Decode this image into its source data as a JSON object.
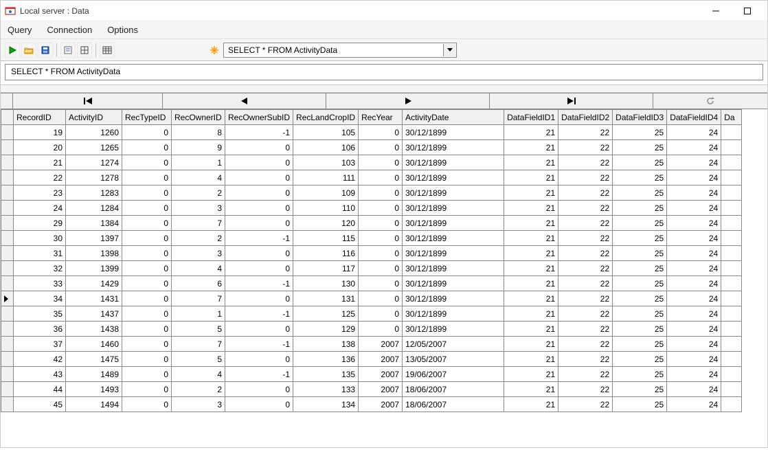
{
  "window": {
    "title": "Local server : Data"
  },
  "menu": {
    "query": "Query",
    "connection": "Connection",
    "options": "Options"
  },
  "toolbar": {
    "query_dropdown": "SELECT * FROM ActivityData"
  },
  "query_text": "SELECT * FROM ActivityData",
  "grid": {
    "current_row_index": 11,
    "columns": [
      "RecordID",
      "ActivityID",
      "RecTypeID",
      "RecOwnerID",
      "RecOwnerSubID",
      "RecLandCropID",
      "RecYear",
      "ActivityDate",
      "DataFieldID1",
      "DataFieldID2",
      "DataFieldID3",
      "DataFieldID4",
      "Da"
    ],
    "rows": [
      {
        "RecordID": 19,
        "ActivityID": 1260,
        "RecTypeID": 0,
        "RecOwnerID": 8,
        "RecOwnerSubID": -1,
        "RecLandCropID": 105,
        "RecYear": 0,
        "ActivityDate": "30/12/1899",
        "DataFieldID1": 21,
        "DataFieldID2": 22,
        "DataFieldID3": 25,
        "DataFieldID4": 24
      },
      {
        "RecordID": 20,
        "ActivityID": 1265,
        "RecTypeID": 0,
        "RecOwnerID": 9,
        "RecOwnerSubID": 0,
        "RecLandCropID": 106,
        "RecYear": 0,
        "ActivityDate": "30/12/1899",
        "DataFieldID1": 21,
        "DataFieldID2": 22,
        "DataFieldID3": 25,
        "DataFieldID4": 24
      },
      {
        "RecordID": 21,
        "ActivityID": 1274,
        "RecTypeID": 0,
        "RecOwnerID": 1,
        "RecOwnerSubID": 0,
        "RecLandCropID": 103,
        "RecYear": 0,
        "ActivityDate": "30/12/1899",
        "DataFieldID1": 21,
        "DataFieldID2": 22,
        "DataFieldID3": 25,
        "DataFieldID4": 24
      },
      {
        "RecordID": 22,
        "ActivityID": 1278,
        "RecTypeID": 0,
        "RecOwnerID": 4,
        "RecOwnerSubID": 0,
        "RecLandCropID": 111,
        "RecYear": 0,
        "ActivityDate": "30/12/1899",
        "DataFieldID1": 21,
        "DataFieldID2": 22,
        "DataFieldID3": 25,
        "DataFieldID4": 24
      },
      {
        "RecordID": 23,
        "ActivityID": 1283,
        "RecTypeID": 0,
        "RecOwnerID": 2,
        "RecOwnerSubID": 0,
        "RecLandCropID": 109,
        "RecYear": 0,
        "ActivityDate": "30/12/1899",
        "DataFieldID1": 21,
        "DataFieldID2": 22,
        "DataFieldID3": 25,
        "DataFieldID4": 24
      },
      {
        "RecordID": 24,
        "ActivityID": 1284,
        "RecTypeID": 0,
        "RecOwnerID": 3,
        "RecOwnerSubID": 0,
        "RecLandCropID": 110,
        "RecYear": 0,
        "ActivityDate": "30/12/1899",
        "DataFieldID1": 21,
        "DataFieldID2": 22,
        "DataFieldID3": 25,
        "DataFieldID4": 24
      },
      {
        "RecordID": 29,
        "ActivityID": 1384,
        "RecTypeID": 0,
        "RecOwnerID": 7,
        "RecOwnerSubID": 0,
        "RecLandCropID": 120,
        "RecYear": 0,
        "ActivityDate": "30/12/1899",
        "DataFieldID1": 21,
        "DataFieldID2": 22,
        "DataFieldID3": 25,
        "DataFieldID4": 24
      },
      {
        "RecordID": 30,
        "ActivityID": 1397,
        "RecTypeID": 0,
        "RecOwnerID": 2,
        "RecOwnerSubID": -1,
        "RecLandCropID": 115,
        "RecYear": 0,
        "ActivityDate": "30/12/1899",
        "DataFieldID1": 21,
        "DataFieldID2": 22,
        "DataFieldID3": 25,
        "DataFieldID4": 24
      },
      {
        "RecordID": 31,
        "ActivityID": 1398,
        "RecTypeID": 0,
        "RecOwnerID": 3,
        "RecOwnerSubID": 0,
        "RecLandCropID": 116,
        "RecYear": 0,
        "ActivityDate": "30/12/1899",
        "DataFieldID1": 21,
        "DataFieldID2": 22,
        "DataFieldID3": 25,
        "DataFieldID4": 24
      },
      {
        "RecordID": 32,
        "ActivityID": 1399,
        "RecTypeID": 0,
        "RecOwnerID": 4,
        "RecOwnerSubID": 0,
        "RecLandCropID": 117,
        "RecYear": 0,
        "ActivityDate": "30/12/1899",
        "DataFieldID1": 21,
        "DataFieldID2": 22,
        "DataFieldID3": 25,
        "DataFieldID4": 24
      },
      {
        "RecordID": 33,
        "ActivityID": 1429,
        "RecTypeID": 0,
        "RecOwnerID": 6,
        "RecOwnerSubID": -1,
        "RecLandCropID": 130,
        "RecYear": 0,
        "ActivityDate": "30/12/1899",
        "DataFieldID1": 21,
        "DataFieldID2": 22,
        "DataFieldID3": 25,
        "DataFieldID4": 24
      },
      {
        "RecordID": 34,
        "ActivityID": 1431,
        "RecTypeID": 0,
        "RecOwnerID": 7,
        "RecOwnerSubID": 0,
        "RecLandCropID": 131,
        "RecYear": 0,
        "ActivityDate": "30/12/1899",
        "DataFieldID1": 21,
        "DataFieldID2": 22,
        "DataFieldID3": 25,
        "DataFieldID4": 24
      },
      {
        "RecordID": 35,
        "ActivityID": 1437,
        "RecTypeID": 0,
        "RecOwnerID": 1,
        "RecOwnerSubID": -1,
        "RecLandCropID": 125,
        "RecYear": 0,
        "ActivityDate": "30/12/1899",
        "DataFieldID1": 21,
        "DataFieldID2": 22,
        "DataFieldID3": 25,
        "DataFieldID4": 24
      },
      {
        "RecordID": 36,
        "ActivityID": 1438,
        "RecTypeID": 0,
        "RecOwnerID": 5,
        "RecOwnerSubID": 0,
        "RecLandCropID": 129,
        "RecYear": 0,
        "ActivityDate": "30/12/1899",
        "DataFieldID1": 21,
        "DataFieldID2": 22,
        "DataFieldID3": 25,
        "DataFieldID4": 24
      },
      {
        "RecordID": 37,
        "ActivityID": 1460,
        "RecTypeID": 0,
        "RecOwnerID": 7,
        "RecOwnerSubID": -1,
        "RecLandCropID": 138,
        "RecYear": 2007,
        "ActivityDate": "12/05/2007",
        "DataFieldID1": 21,
        "DataFieldID2": 22,
        "DataFieldID3": 25,
        "DataFieldID4": 24
      },
      {
        "RecordID": 42,
        "ActivityID": 1475,
        "RecTypeID": 0,
        "RecOwnerID": 5,
        "RecOwnerSubID": 0,
        "RecLandCropID": 136,
        "RecYear": 2007,
        "ActivityDate": "13/05/2007",
        "DataFieldID1": 21,
        "DataFieldID2": 22,
        "DataFieldID3": 25,
        "DataFieldID4": 24
      },
      {
        "RecordID": 43,
        "ActivityID": 1489,
        "RecTypeID": 0,
        "RecOwnerID": 4,
        "RecOwnerSubID": -1,
        "RecLandCropID": 135,
        "RecYear": 2007,
        "ActivityDate": "19/06/2007",
        "DataFieldID1": 21,
        "DataFieldID2": 22,
        "DataFieldID3": 25,
        "DataFieldID4": 24
      },
      {
        "RecordID": 44,
        "ActivityID": 1493,
        "RecTypeID": 0,
        "RecOwnerID": 2,
        "RecOwnerSubID": 0,
        "RecLandCropID": 133,
        "RecYear": 2007,
        "ActivityDate": "18/06/2007",
        "DataFieldID1": 21,
        "DataFieldID2": 22,
        "DataFieldID3": 25,
        "DataFieldID4": 24
      },
      {
        "RecordID": 45,
        "ActivityID": 1494,
        "RecTypeID": 0,
        "RecOwnerID": 3,
        "RecOwnerSubID": 0,
        "RecLandCropID": 134,
        "RecYear": 2007,
        "ActivityDate": "18/06/2007",
        "DataFieldID1": 21,
        "DataFieldID2": 22,
        "DataFieldID3": 25,
        "DataFieldID4": 24
      }
    ]
  }
}
